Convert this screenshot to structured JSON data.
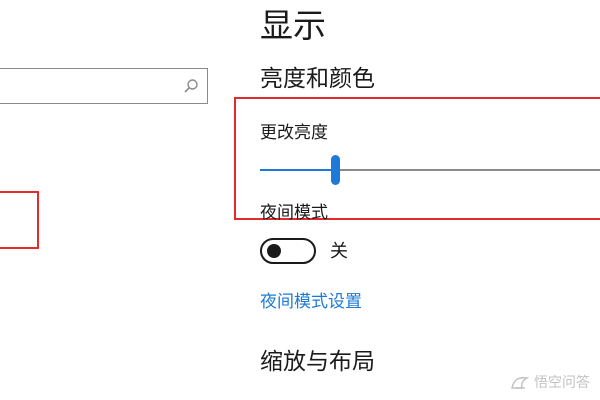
{
  "colors": {
    "accent": "#1d7ad6",
    "highlight_border": "#e32b2b",
    "text": "#1a1a1a"
  },
  "left_pane": {
    "search": {
      "value": "",
      "placeholder": "",
      "icon": "search-icon"
    }
  },
  "display": {
    "title": "显示",
    "brightness_color": {
      "heading": "亮度和颜色",
      "brightness_label": "更改亮度",
      "brightness_level_fraction": 0.22
    },
    "night_mode": {
      "label": "夜间模式",
      "toggle_state": "关",
      "toggle_on": false,
      "settings_link": "夜间模式设置"
    },
    "scale_layout": {
      "heading": "缩放与布局"
    }
  },
  "watermark": {
    "text": "悟空问答",
    "icon": "brand-logo-icon"
  }
}
